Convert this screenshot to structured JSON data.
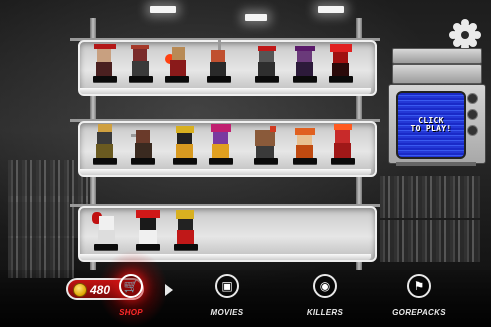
{
  "coins": {
    "amount": "480"
  },
  "tv": {
    "screen_text": "CLICK\nTO PLAY!"
  },
  "nav": {
    "active": "shop",
    "items": [
      {
        "id": "shop",
        "label": "SHOP",
        "icon": "shopping-cart-icon"
      },
      {
        "id": "movies",
        "label": "MOVIES",
        "icon": "film-reel-icon"
      },
      {
        "id": "killers",
        "label": "KILLERS",
        "icon": "killer-mask-icon"
      },
      {
        "id": "gorepacks",
        "label": "GOREPACKS",
        "icon": "flag-icon"
      }
    ]
  },
  "settings": {
    "icon": "gear-icon"
  },
  "shelves": [
    {
      "figures": [
        "red-horned-killer-figure",
        "zombie-figure",
        "bloody-gunner-figure",
        "axe-wielder-figure",
        "red-cap-killer-figure",
        "purple-hooded-figure",
        "red-demon-figure"
      ]
    },
    {
      "figures": [
        "feathered-killer-figure",
        "brown-coat-killer-figure",
        "yellow-helmet-figure",
        "harlequin-jester-figure",
        "blocky-brute-figure",
        "orange-clown-figure",
        "red-fire-figure"
      ]
    },
    {
      "figures": [
        "bloody-ghost-figure",
        "w-mask-figure",
        "yellow-bucket-figure"
      ]
    }
  ],
  "colors": {
    "accent": "#d41414",
    "shelf": "#d9d9d9",
    "tv_screen": "#2438d6",
    "coin_gold": "#f2b705"
  }
}
